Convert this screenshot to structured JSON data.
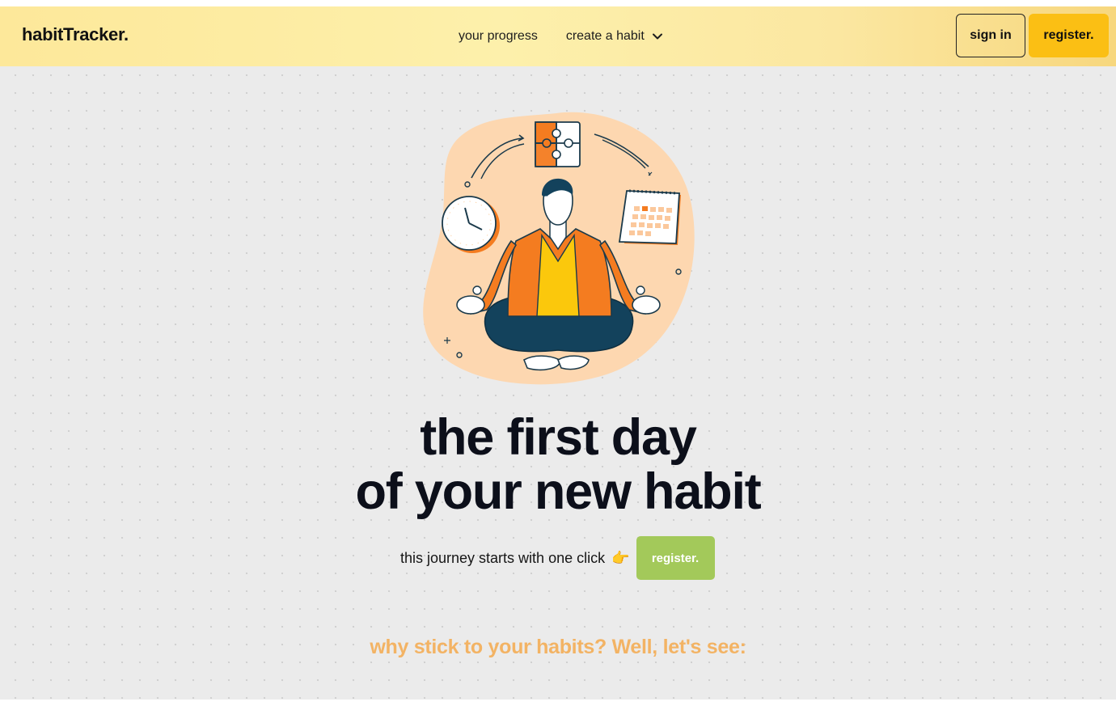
{
  "nav": {
    "logo": "habitTracker.",
    "links": [
      {
        "label": "your progress"
      },
      {
        "label": "create a habit",
        "icon": "chevron-down-icon"
      }
    ],
    "sign_in": "sign in",
    "register": "register."
  },
  "hero": {
    "headline_line1": "the first day",
    "headline_line2": "of your new habit",
    "cta_text": "this journey starts with one click",
    "cta_emoji": "👉",
    "cta_button": "register."
  },
  "section": {
    "subheading": "why stick to your habits? Well, let's see:"
  },
  "colors": {
    "nav_bg": "#fdf0ab",
    "register_top": "#fbbf14",
    "register_cta": "#a3c95a",
    "subheading": "#f3b364",
    "illustration_accent": "#f47c20",
    "illustration_blob": "#fdd7b0"
  }
}
